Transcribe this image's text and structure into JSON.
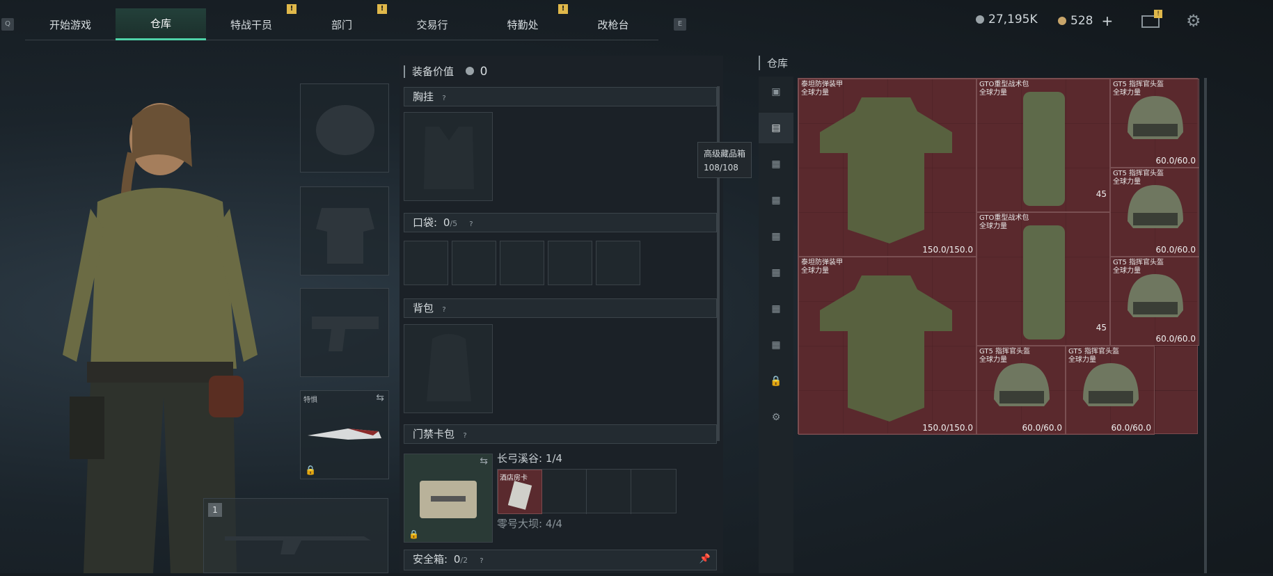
{
  "nav": {
    "key_left": "Q",
    "key_right": "E",
    "tabs": [
      {
        "label": "开始游戏",
        "active": false,
        "badge": ""
      },
      {
        "label": "仓库",
        "active": true,
        "badge": ""
      },
      {
        "label": "特战干员",
        "active": false,
        "badge": "!"
      },
      {
        "label": "部门",
        "active": false,
        "badge": "!"
      },
      {
        "label": "交易行",
        "active": false,
        "badge": ""
      },
      {
        "label": "特勤处",
        "active": false,
        "badge": "!"
      },
      {
        "label": "改枪台",
        "active": false,
        "badge": ""
      }
    ]
  },
  "currency": {
    "silver": "27,195K",
    "gold": "528",
    "plus": "+",
    "mail_badge": "!",
    "silver_color": "#9aa3a8",
    "gold_color": "#c8a56a"
  },
  "loadout": {
    "melee_label": "特惧",
    "weapon_slot_index": "1"
  },
  "equipment": {
    "value_label": "装备价值",
    "value": "0",
    "chest_rig": "胸挂",
    "pockets_label": "口袋:",
    "pockets_count": "0",
    "pockets_cap": "/5",
    "backpack": "背包",
    "keycard_case": "门禁卡包",
    "keycard_map1": "长弓溪谷: 1/4",
    "keycard_item": "酒店房卡",
    "keycard_map2": "零号大坝: 4/4",
    "safe_box_label": "安全箱:",
    "safe_box_count": "0",
    "safe_box_cap": "/2"
  },
  "tooltip": {
    "title": "高级藏品箱",
    "value": "108/108"
  },
  "storage": {
    "title": "仓库",
    "items": [
      {
        "name": "泰坦防弹装甲",
        "sub": "全球力量",
        "durability": "150.0/150.0",
        "count": ""
      },
      {
        "name": "GTO重型战术包",
        "sub": "全球力量",
        "durability": "",
        "count": "45"
      },
      {
        "name": "GT5 指挥官头盔",
        "sub": "全球力量",
        "durability": "60.0/60.0",
        "count": ""
      },
      {
        "name": "GT5 指挥官头盔",
        "sub": "全球力量",
        "durability": "60.0/60.0",
        "count": ""
      },
      {
        "name": "GTO重型战术包",
        "sub": "全球力量",
        "durability": "",
        "count": "45"
      },
      {
        "name": "泰坦防弹装甲",
        "sub": "全球力量",
        "durability": "150.0/150.0",
        "count": ""
      },
      {
        "name": "GT5 指挥官头盔",
        "sub": "全球力量",
        "durability": "60.0/60.0",
        "count": ""
      },
      {
        "name": "GT5 指挥官头盔",
        "sub": "全球力量",
        "durability": "60.0/60.0",
        "count": ""
      },
      {
        "name": "GT5 指挥官头盔",
        "sub": "全球力量",
        "durability": "60.0/60.0",
        "count": ""
      }
    ],
    "side_tabs": [
      "box-icon",
      "collection-box-icon",
      "storage-box-icon",
      "storage-box-icon",
      "storage-box-icon",
      "storage-box-icon",
      "storage-box-icon",
      "storage-box-icon",
      "lock-icon",
      "gear-icon"
    ]
  }
}
